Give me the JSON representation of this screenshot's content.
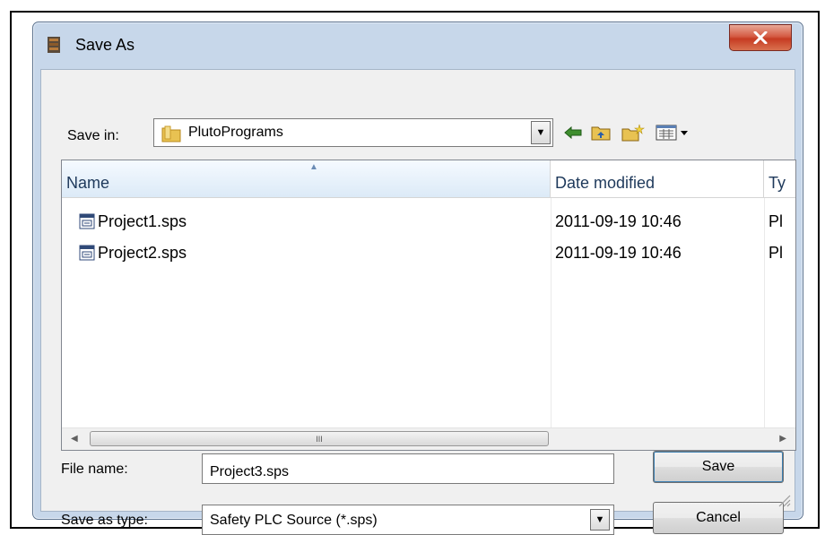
{
  "window": {
    "title": "Save As",
    "close_label": "X"
  },
  "toolbar": {
    "save_in_label": "Save in:",
    "save_in_value": "PlutoPrograms",
    "icons": [
      "back-arrow-icon",
      "up-folder-icon",
      "new-folder-icon",
      "view-menu-icon"
    ]
  },
  "file_list": {
    "columns": [
      "Name",
      "Date modified",
      "Ty"
    ],
    "rows": [
      {
        "name": "Project1.sps",
        "date": "2011-09-19 10:46",
        "type": "Pl"
      },
      {
        "name": "Project2.sps",
        "date": "2011-09-19 10:46",
        "type": "Pl"
      }
    ],
    "scroll_thumb_grip": "III"
  },
  "form": {
    "file_name_label": "File name:",
    "file_name_value": "Project3.sps",
    "save_as_type_label": "Save as type:",
    "save_as_type_value": "Safety PLC Source (*.sps)"
  },
  "buttons": {
    "save": "Save",
    "cancel": "Cancel"
  },
  "colors": {
    "window_frame": "#c7d7ea",
    "close_button": "#c63b22",
    "header_text": "#1e395b"
  }
}
